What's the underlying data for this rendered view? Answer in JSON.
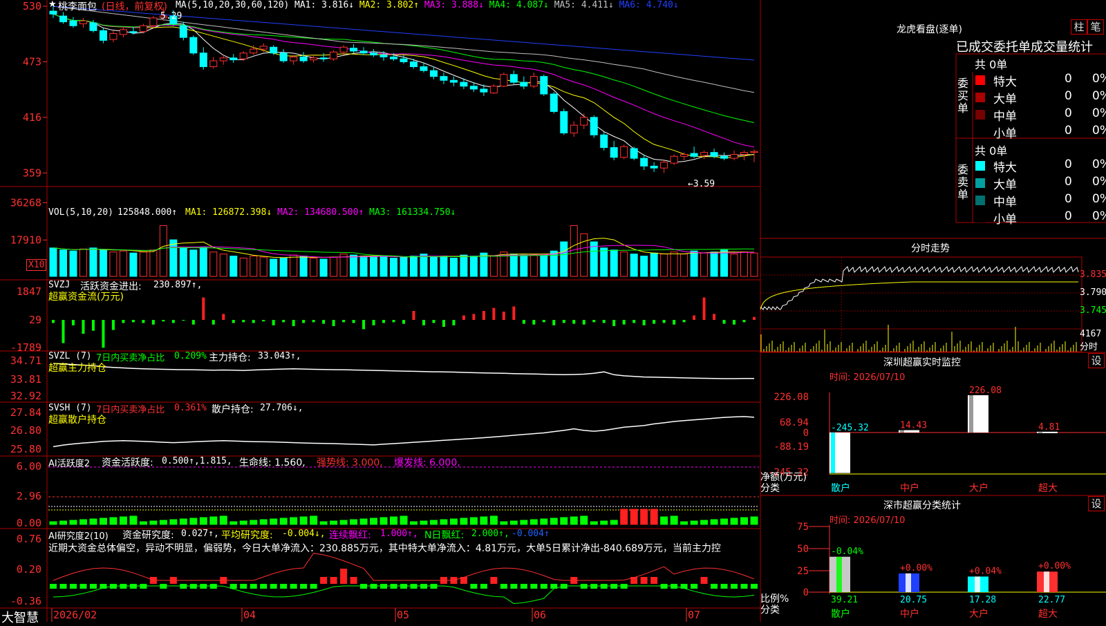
{
  "stock": {
    "star": "★",
    "name": "桃李面包",
    "period": "(日线，前复权)"
  },
  "main_chart": {
    "ma_label": "MA(5,10,20,30,60,120)",
    "ma_values": [
      {
        "name": "MA1:",
        "value": "3.816↓",
        "color": "#ffffff"
      },
      {
        "name": "MA2:",
        "value": "3.802↑",
        "color": "#ffff00"
      },
      {
        "name": "MA3:",
        "value": "3.888↓",
        "color": "#ff00ff"
      },
      {
        "name": "MA4:",
        "value": "4.087↓",
        "color": "#00ff00"
      },
      {
        "name": "MA5:",
        "value": "4.411↓",
        "color": "#c0c0c0"
      },
      {
        "name": "MA6:",
        "value": "4.740↓",
        "color": "#2040ff"
      }
    ],
    "y_ticks": [
      "530",
      "473",
      "416",
      "359"
    ],
    "high_marker": "5.29",
    "low_marker": "←3.59",
    "price_range": [
      3.45,
      5.35
    ],
    "ohlc": [
      [
        5.25,
        5.3,
        5.18,
        5.22
      ],
      [
        5.2,
        5.24,
        5.12,
        5.14
      ],
      [
        5.15,
        5.19,
        5.08,
        5.1
      ],
      [
        5.12,
        5.18,
        5.08,
        5.15
      ],
      [
        5.13,
        5.16,
        5.03,
        5.05
      ],
      [
        5.05,
        5.08,
        4.92,
        4.95
      ],
      [
        4.96,
        5.05,
        4.93,
        5.02
      ],
      [
        5.01,
        5.08,
        4.98,
        5.06
      ],
      [
        5.04,
        5.09,
        5.01,
        5.03
      ],
      [
        5.04,
        5.12,
        5.02,
        5.1
      ],
      [
        5.1,
        5.2,
        5.08,
        5.18
      ],
      [
        5.18,
        5.29,
        5.15,
        5.2
      ],
      [
        5.2,
        5.26,
        5.1,
        5.12
      ],
      [
        5.1,
        5.14,
        4.95,
        4.98
      ],
      [
        4.98,
        5.0,
        4.8,
        4.82
      ],
      [
        4.82,
        4.88,
        4.65,
        4.68
      ],
      [
        4.68,
        4.78,
        4.66,
        4.74
      ],
      [
        4.74,
        4.8,
        4.7,
        4.77
      ],
      [
        4.77,
        4.81,
        4.72,
        4.75
      ],
      [
        4.76,
        4.84,
        4.74,
        4.82
      ],
      [
        4.82,
        4.9,
        4.8,
        4.86
      ],
      [
        4.86,
        4.92,
        4.83,
        4.89
      ],
      [
        4.88,
        4.9,
        4.8,
        4.82
      ],
      [
        4.82,
        4.86,
        4.72,
        4.74
      ],
      [
        4.74,
        4.8,
        4.7,
        4.78
      ],
      [
        4.78,
        4.83,
        4.72,
        4.74
      ],
      [
        4.75,
        4.8,
        4.72,
        4.77
      ],
      [
        4.77,
        4.82,
        4.73,
        4.76
      ],
      [
        4.76,
        4.85,
        4.74,
        4.83
      ],
      [
        4.83,
        4.9,
        4.8,
        4.88
      ],
      [
        4.87,
        4.91,
        4.82,
        4.84
      ],
      [
        4.84,
        4.88,
        4.8,
        4.82
      ],
      [
        4.82,
        4.86,
        4.78,
        4.8
      ],
      [
        4.8,
        4.84,
        4.74,
        4.78
      ],
      [
        4.78,
        4.82,
        4.74,
        4.76
      ],
      [
        4.76,
        4.8,
        4.71,
        4.73
      ],
      [
        4.73,
        4.76,
        4.66,
        4.68
      ],
      [
        4.68,
        4.72,
        4.62,
        4.64
      ],
      [
        4.64,
        4.68,
        4.55,
        4.58
      ],
      [
        4.58,
        4.62,
        4.5,
        4.54
      ],
      [
        4.54,
        4.58,
        4.48,
        4.52
      ],
      [
        4.52,
        4.56,
        4.45,
        4.48
      ],
      [
        4.48,
        4.52,
        4.42,
        4.45
      ],
      [
        4.45,
        4.5,
        4.38,
        4.42
      ],
      [
        4.41,
        4.5,
        4.4,
        4.48
      ],
      [
        4.48,
        4.62,
        4.47,
        4.6
      ],
      [
        4.6,
        4.64,
        4.5,
        4.52
      ],
      [
        4.52,
        4.58,
        4.45,
        4.48
      ],
      [
        4.48,
        4.62,
        4.46,
        4.58
      ],
      [
        4.58,
        4.6,
        4.38,
        4.4
      ],
      [
        4.4,
        4.42,
        4.2,
        4.22
      ],
      [
        4.22,
        4.25,
        3.98,
        4.0
      ],
      [
        4.0,
        4.12,
        3.96,
        4.08
      ],
      [
        4.08,
        4.2,
        4.04,
        4.16
      ],
      [
        4.16,
        4.18,
        3.95,
        3.98
      ],
      [
        3.98,
        4.01,
        3.82,
        3.85
      ],
      [
        3.85,
        3.92,
        3.72,
        3.75
      ],
      [
        3.75,
        3.88,
        3.73,
        3.86
      ],
      [
        3.84,
        3.86,
        3.72,
        3.74
      ],
      [
        3.74,
        3.78,
        3.62,
        3.66
      ],
      [
        3.66,
        3.7,
        3.6,
        3.64
      ],
      [
        3.64,
        3.72,
        3.59,
        3.7
      ],
      [
        3.69,
        3.78,
        3.67,
        3.76
      ],
      [
        3.76,
        3.8,
        3.72,
        3.78
      ],
      [
        3.79,
        3.86,
        3.74,
        3.76
      ],
      [
        3.77,
        3.82,
        3.73,
        3.8
      ],
      [
        3.8,
        3.84,
        3.74,
        3.76
      ],
      [
        3.76,
        3.8,
        3.72,
        3.74
      ],
      [
        3.74,
        3.82,
        3.72,
        3.78
      ],
      [
        3.78,
        3.82,
        3.72,
        3.8
      ],
      [
        3.8,
        3.83,
        3.7,
        3.81
      ]
    ]
  },
  "volume_chart": {
    "label": "VOL(5,10,20)",
    "value": "125848.000↑",
    "ma": [
      {
        "name": "MA1:",
        "value": "126872.398↓",
        "color": "#ffff00"
      },
      {
        "name": "MA2:",
        "value": "134680.500↑",
        "color": "#ff00ff"
      },
      {
        "name": "MA3:",
        "value": "161334.750↓",
        "color": "#00ff00"
      }
    ],
    "y_ticks": [
      "36268",
      "17910"
    ],
    "unit": "X10",
    "values": [
      14000,
      13000,
      12500,
      13500,
      14000,
      13000,
      12000,
      12500,
      11500,
      12000,
      13000,
      25000,
      18000,
      14000,
      13000,
      14500,
      12000,
      11000,
      10000,
      9000,
      10000,
      9500,
      8500,
      9000,
      10500,
      10000,
      9000,
      8500,
      9500,
      11000,
      10500,
      10000,
      9500,
      10000,
      9000,
      9500,
      10000,
      11000,
      9500,
      10000,
      9000,
      10500,
      10000,
      11500,
      10000,
      12000,
      11000,
      10500,
      11000,
      10500,
      12500,
      17000,
      25000,
      21000,
      17000,
      14000,
      13000,
      12000,
      11000,
      10000,
      11500,
      11000,
      12000,
      11000,
      12500,
      11500,
      12000,
      13000,
      11000,
      12000,
      11500
    ]
  },
  "svzj_chart": {
    "title_prefix": "SVZJ",
    "label": "活跃资金进出:",
    "value": "230.897↑,",
    "sub": "超赢资金流(万元)",
    "y_ticks": [
      "1847",
      "29",
      "-1789"
    ],
    "values": [
      -200,
      -1500,
      -350,
      -900,
      -700,
      -1800,
      -650,
      -200,
      -150,
      -200,
      -300,
      -100,
      -200,
      -50,
      -300,
      1500,
      -300,
      400,
      -200,
      -150,
      -200,
      -100,
      -350,
      -150,
      -400,
      -200,
      -150,
      -250,
      -400,
      -150,
      -200,
      -600,
      -350,
      -200,
      -150,
      -250,
      600,
      -350,
      -200,
      -450,
      -350,
      300,
      400,
      600,
      800,
      550,
      900,
      -250,
      -300,
      -150,
      -350,
      -200,
      -250,
      -300,
      -150,
      -200,
      -400,
      -300,
      -200,
      -350,
      -250,
      -200,
      -300,
      -150,
      300,
      1500,
      400,
      -250,
      -300,
      -150,
      200
    ]
  },
  "svzl_chart": {
    "title_prefix": "SVZL (7)",
    "label": "7日内买卖净占比",
    "pct": "0.209%",
    "sub_label": "主力持仓:",
    "value": "33.043↑,",
    "sub": "超赢主力持仓",
    "y_ticks": [
      "34.71",
      "33.81",
      "32.92"
    ],
    "values": [
      34.3,
      34.25,
      34.2,
      34.15,
      34.1,
      34.0,
      33.95,
      33.9,
      33.85,
      33.82,
      33.8,
      33.78,
      33.76,
      33.75,
      33.74,
      33.72,
      33.7,
      33.72,
      33.7,
      33.68,
      33.72,
      33.75,
      33.78,
      33.8,
      33.82,
      33.8,
      33.78,
      33.76,
      33.75,
      33.74,
      33.72,
      33.7,
      33.68,
      33.66,
      33.64,
      33.62,
      33.6,
      33.58,
      33.56,
      33.55,
      33.53,
      33.5,
      33.48,
      33.46,
      33.44,
      33.42,
      33.4,
      33.38,
      33.36,
      33.34,
      33.32,
      33.3,
      33.32,
      33.35,
      33.42,
      33.55,
      33.3,
      33.2,
      33.15,
      33.1,
      33.08,
      33.06,
      33.04,
      33.02,
      33.0,
      32.98,
      32.96,
      32.95,
      32.95,
      32.96,
      32.96
    ]
  },
  "svsh_chart": {
    "title_prefix": "SVSH (7)",
    "label": "7日内买卖净占比",
    "pct": "0.361%",
    "sub_label": "散户持仓:",
    "value": "27.706↓,",
    "sub": "超赢散户持仓",
    "y_ticks": [
      "27.84",
      "26.80",
      "25.80"
    ],
    "values": [
      25.95,
      26.05,
      26.12,
      26.18,
      26.22,
      26.28,
      26.3,
      26.32,
      26.3,
      26.28,
      26.25,
      26.22,
      26.2,
      26.22,
      26.25,
      26.28,
      26.3,
      26.32,
      26.3,
      26.28,
      26.26,
      26.25,
      26.24,
      26.22,
      26.2,
      26.18,
      26.16,
      26.15,
      26.14,
      26.12,
      26.1,
      26.08,
      26.06,
      26.1,
      26.14,
      26.18,
      26.22,
      26.26,
      26.3,
      26.34,
      26.38,
      26.42,
      26.46,
      26.5,
      26.55,
      26.6,
      26.65,
      26.7,
      26.75,
      26.8,
      26.88,
      26.95,
      27.05,
      26.95,
      26.9,
      26.95,
      27.05,
      27.15,
      27.2,
      27.25,
      27.35,
      27.42,
      27.5,
      27.55,
      27.6,
      27.65,
      27.7,
      27.75,
      27.78,
      27.8,
      27.76
    ]
  },
  "ai_active_chart": {
    "title": "AI活跃度2",
    "label": "资金活跃度:",
    "values_text": "0.500↑,1.815,",
    "life_line": "生命线: 1.560,",
    "strong_line": "强势线: 3.000,",
    "burst_line": "爆发线: 6.000,",
    "y_ticks": [
      "6.00",
      "2.96",
      "0.00"
    ]
  },
  "ai_research_chart": {
    "title": "AI研究度2(10)",
    "label1": "资金研究度:",
    "value1": "0.027↑,",
    "label2": "平均研究度:",
    "value2": "-0.004↓,",
    "label3": "连续飘红:",
    "value3": "1.000↑,",
    "label4": "N日飘红:",
    "value4": "2.000↑,",
    "value5": "-0.004↑",
    "commentary": "近期大资金总体偏空，异动不明显，偏弱势，今日大单净流入：230.885万元，其中特大单净流入：4.81万元，大单5日累计净出-840.689万元，当前主力控",
    "y_ticks": [
      "0.76",
      "0.20",
      "-0.36"
    ]
  },
  "x_axis": {
    "brand": "大智慧",
    "labels": [
      "2026/02",
      "04",
      "05",
      "06",
      "07"
    ]
  },
  "right_panel": {
    "lhb_title": "龙虎看盘(逐单)",
    "btn_zhu": "柱",
    "btn_bi": "笔",
    "header": "已成交委托单成交量统计",
    "buy_label": "委买单",
    "sell_label": "委卖单",
    "buy_total": "共 0单",
    "sell_total": "共 0单",
    "buy_rows": [
      {
        "name": "特大",
        "count": "0",
        "pct": "0%",
        "color": "#ff0000"
      },
      {
        "name": "大单",
        "count": "0",
        "pct": "0%",
        "color": "#aa0000"
      },
      {
        "name": "中单",
        "count": "0",
        "pct": "0%",
        "color": "#770000"
      },
      {
        "name": "小单",
        "count": "0",
        "pct": "0%",
        "color": "#000000"
      }
    ],
    "sell_rows": [
      {
        "name": "特大",
        "count": "0",
        "pct": "0%",
        "color": "#00ffff"
      },
      {
        "name": "大单",
        "count": "0",
        "pct": "0%",
        "color": "#00a0a0"
      },
      {
        "name": "中单",
        "count": "0",
        "pct": "0%",
        "color": "#007070"
      },
      {
        "name": "小单",
        "count": "0",
        "pct": "0%",
        "color": "#000000"
      }
    ],
    "intraday_title": "分时走势",
    "intraday_y": [
      "3.835",
      "3.790",
      "3.745"
    ],
    "intraday_vol_label": "4167",
    "intraday_vol_unit": "分时",
    "monitor_title": "深圳超赢实时监控",
    "monitor_btn": "设",
    "monitor_time": "时间: 2026/07/10",
    "monitor_y": [
      "226.08",
      "68.94",
      "0",
      "-88.19",
      "-245.32"
    ],
    "monitor_ylabel": "净额(万元)",
    "monitor_xlabel": "分类",
    "monitor_bars": [
      {
        "cat": "散户",
        "value": -245.32,
        "label": "-245.32"
      },
      {
        "cat": "中户",
        "value": 14.43,
        "label": "14.43"
      },
      {
        "cat": "大户",
        "value": 226.08,
        "label": "226.08"
      },
      {
        "cat": "超大",
        "value": 4.81,
        "label": "4.81"
      }
    ],
    "stat_title": "深市超赢分类统计",
    "stat_btn": "设",
    "stat_time": "时间: 2026/07/10",
    "stat_y": [
      "75",
      "50",
      "25",
      "0"
    ],
    "stat_ylabel": "比例%",
    "stat_xlabel": "分类",
    "stat_bars": [
      {
        "cat": "散户",
        "value": 39.21,
        "label": "39.21",
        "delta": "-0.04%",
        "fill": "#c8c8c8",
        "accent": "#00ff00"
      },
      {
        "cat": "中户",
        "value": 20.75,
        "label": "20.75",
        "delta": "+0.00%",
        "fill": "#2040ff",
        "accent": "#ffffff"
      },
      {
        "cat": "大户",
        "value": 17.28,
        "label": "17.28",
        "delta": "+0.04%",
        "fill": "#00ffff",
        "accent": "#ffffff"
      },
      {
        "cat": "超大",
        "value": 22.77,
        "label": "22.77",
        "delta": "+0.00%",
        "fill": "#ff3030",
        "accent": "#ffffff"
      }
    ]
  }
}
